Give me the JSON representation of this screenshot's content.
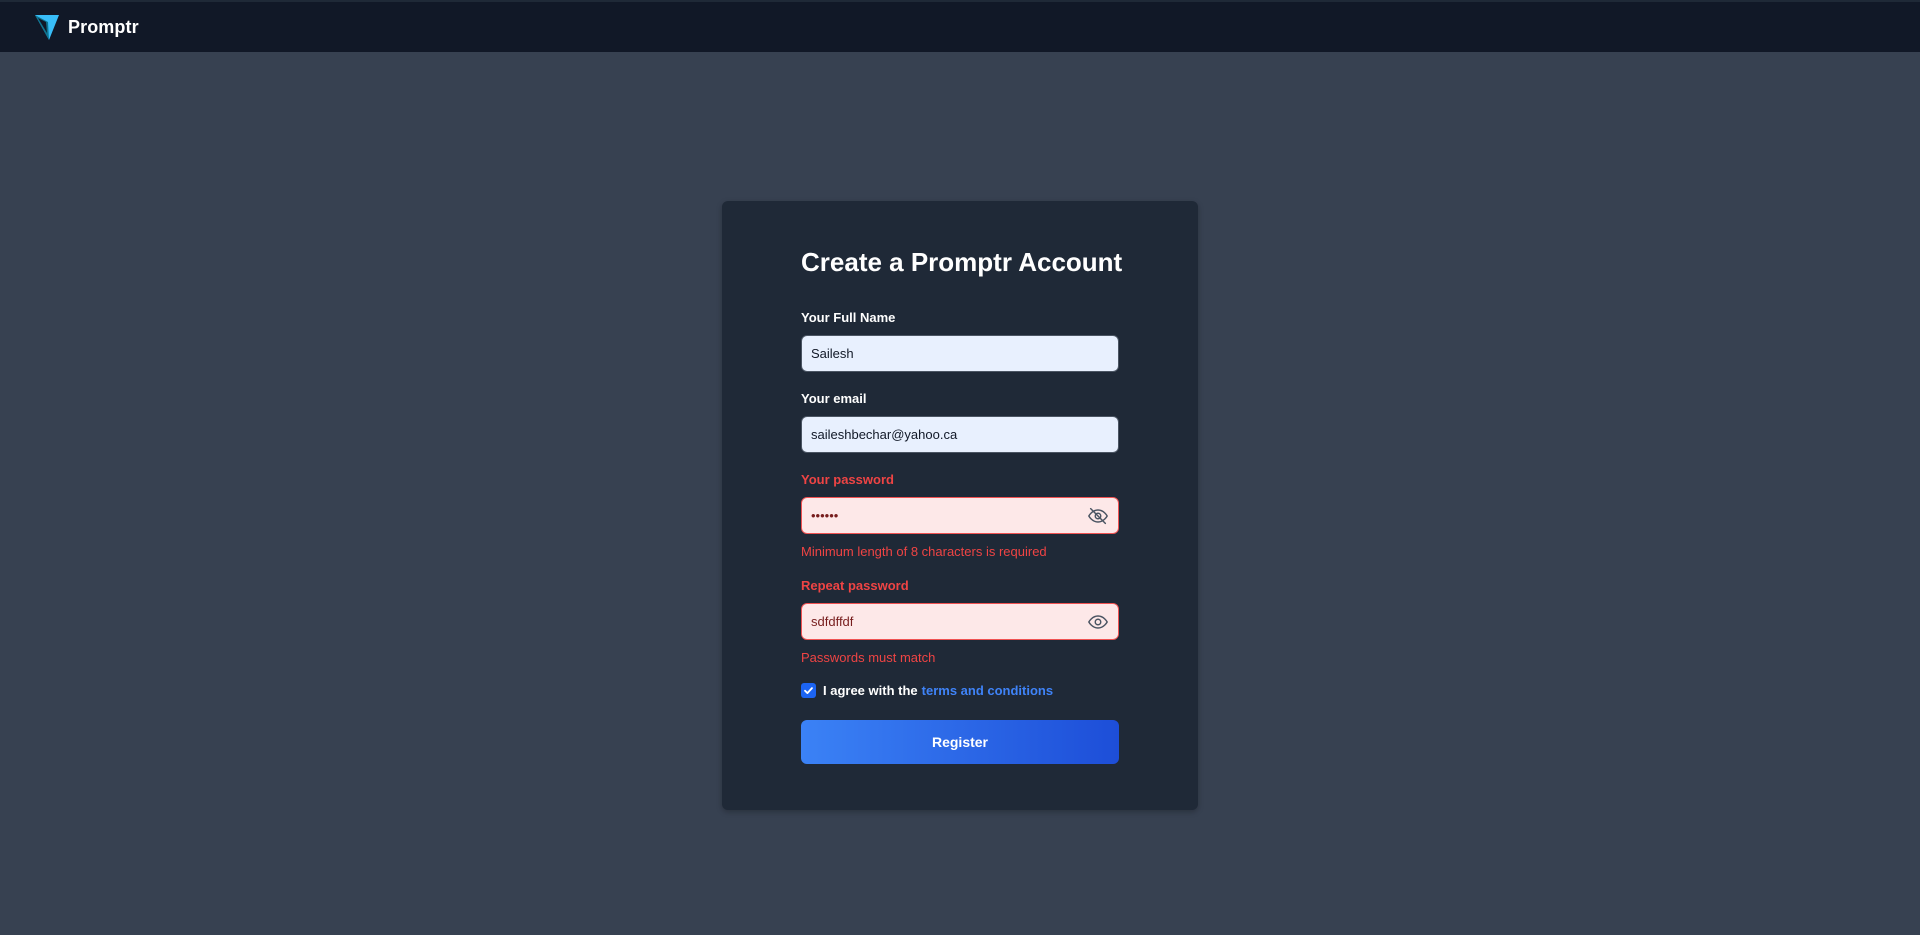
{
  "navbar": {
    "brand_name": "Promptr",
    "logo_icon": "promptr-logo-icon"
  },
  "form": {
    "title": "Create a Promptr Account",
    "full_name": {
      "label": "Your Full Name",
      "value": "Sailesh"
    },
    "email": {
      "label": "Your email",
      "value": "saileshbechar@yahoo.ca"
    },
    "password": {
      "label": "Your password",
      "value": "••••••",
      "error": "Minimum length of 8 characters is required",
      "toggle_icon": "eye-slash-icon"
    },
    "repeat_password": {
      "label": "Repeat password",
      "value": "sdfdffdf",
      "error": "Passwords must match",
      "toggle_icon": "eye-icon"
    },
    "terms": {
      "checked": true,
      "prefix": "I agree with the",
      "link_text": "terms and conditions"
    },
    "submit_label": "Register"
  },
  "colors": {
    "page_bg": "#374151",
    "navbar_bg": "#111827",
    "card_bg": "#1f2937",
    "error": "#ef4444",
    "link": "#3f83f8",
    "button_start": "#3b82f6",
    "button_end": "#1d4ed8"
  }
}
